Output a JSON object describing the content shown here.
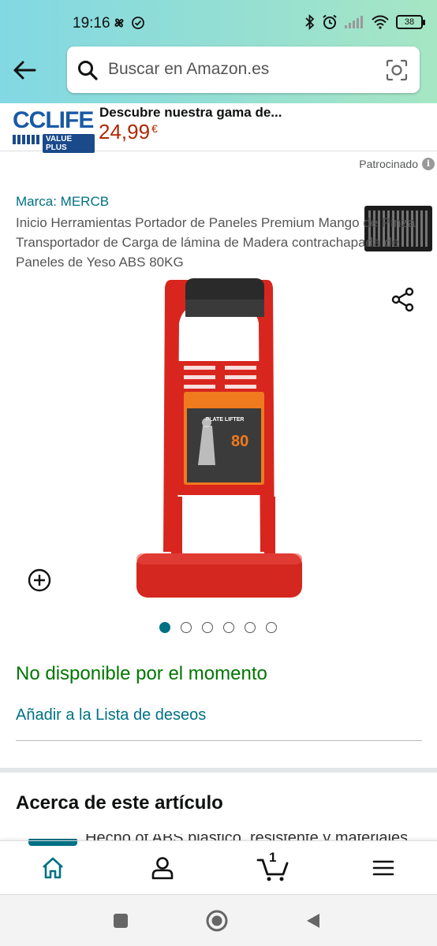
{
  "status_bar": {
    "time": "19:16",
    "battery": "38"
  },
  "search": {
    "placeholder": "Buscar en Amazon.es"
  },
  "banner": {
    "logo_text": "CCLIFE",
    "logo_sub": "VALUE PLUS",
    "title": "Descubre nuestra gama de...",
    "price": "24,99",
    "currency": "€",
    "sponsored_label": "Patrocinado"
  },
  "product": {
    "brand": "Marca: MERCB",
    "title": "Inicio Herramientas Portador de Paneles Premium Mango de Pinza Transportador de Carga de lámina de Madera contrachapada de Paneles de Yeso ABS 80KG",
    "image_label": "PLATE LIFTER",
    "image_load": "80",
    "image_count": 6,
    "image_active_index": 0,
    "availability": "No disponible por el momento",
    "wishlist_label": "Añadir a la Lista de deseos"
  },
  "about": {
    "title": "Acerca de este artículo",
    "first_bullet_partial": "Hecho of ABS plastico, resistente y materiales del..."
  },
  "bottom_nav": {
    "cart_count": "1",
    "items": [
      "home-icon",
      "user-icon",
      "cart-icon",
      "menu-icon"
    ]
  },
  "colors": {
    "accent": "#007185",
    "price": "#b12704",
    "availability": "#007600",
    "product_red": "#d8261e"
  }
}
